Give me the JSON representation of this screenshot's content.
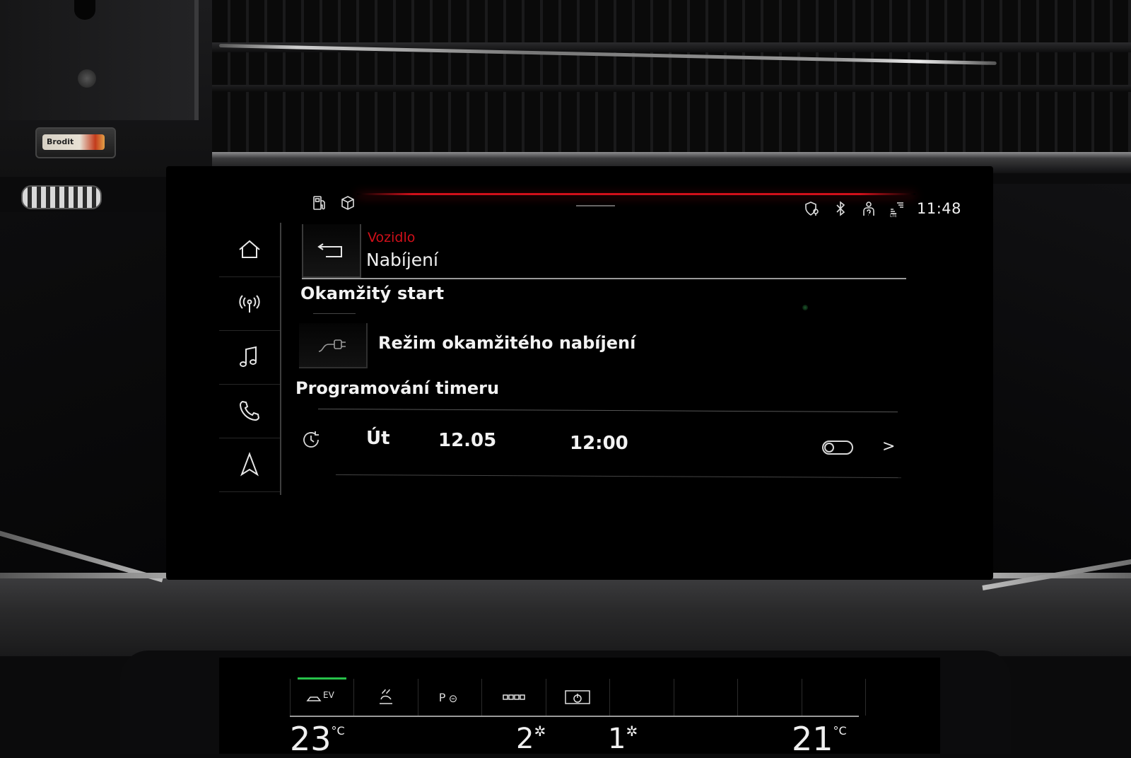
{
  "status_bar": {
    "left_icons": [
      "fuel-pump-icon",
      "package-box-icon"
    ],
    "right_icons": [
      "shield-location-icon",
      "bluetooth-icon",
      "person-help-icon",
      "lte-signal-icon"
    ],
    "time": "11:48"
  },
  "nav": {
    "items": [
      {
        "id": "home",
        "icon": "home-icon"
      },
      {
        "id": "radio",
        "icon": "radio-antenna-icon"
      },
      {
        "id": "media",
        "icon": "music-note-icon"
      },
      {
        "id": "phone",
        "icon": "phone-icon"
      },
      {
        "id": "navigation",
        "icon": "navigation-arrow-icon"
      }
    ]
  },
  "header": {
    "breadcrumb": "Vozidlo",
    "title": "Nabíjení",
    "back_icon": "back-arrow-icon"
  },
  "instant_start": {
    "section_title": "Okamžitý start",
    "item_icon": "charging-plug-icon",
    "item_label": "Režim okamžitého nabíjení"
  },
  "timer": {
    "section_title": "Programování timeru",
    "rows": [
      {
        "icon": "timer-clock-icon",
        "day": "Út",
        "date": "12.05",
        "time": "12:00",
        "enabled": false
      }
    ]
  },
  "climate": {
    "tabs": [
      {
        "label": "EV",
        "icon": "ev-car-icon",
        "active": true
      },
      {
        "label": "",
        "icon": "seat-heating-icon",
        "active": false
      },
      {
        "label": "P",
        "icon": "parking-heater-icon",
        "active": false
      },
      {
        "label": "",
        "icon": "rear-window-icon",
        "active": false
      },
      {
        "label": "",
        "icon": "climate-power-icon",
        "active": false
      },
      {
        "label": "",
        "icon": "",
        "active": false
      },
      {
        "label": "",
        "icon": "",
        "active": false
      },
      {
        "label": "",
        "icon": "",
        "active": false
      },
      {
        "label": "",
        "icon": "",
        "active": false
      }
    ],
    "left_temp": "23",
    "right_temp": "21",
    "temp_unit": "°C",
    "fan_left": "2",
    "fan_right": "1"
  },
  "misc": {
    "holder_brand": "Brodit"
  },
  "colors": {
    "accent_red": "#d1101a",
    "active_green": "#27c14a",
    "text": "#f2f2f2"
  }
}
